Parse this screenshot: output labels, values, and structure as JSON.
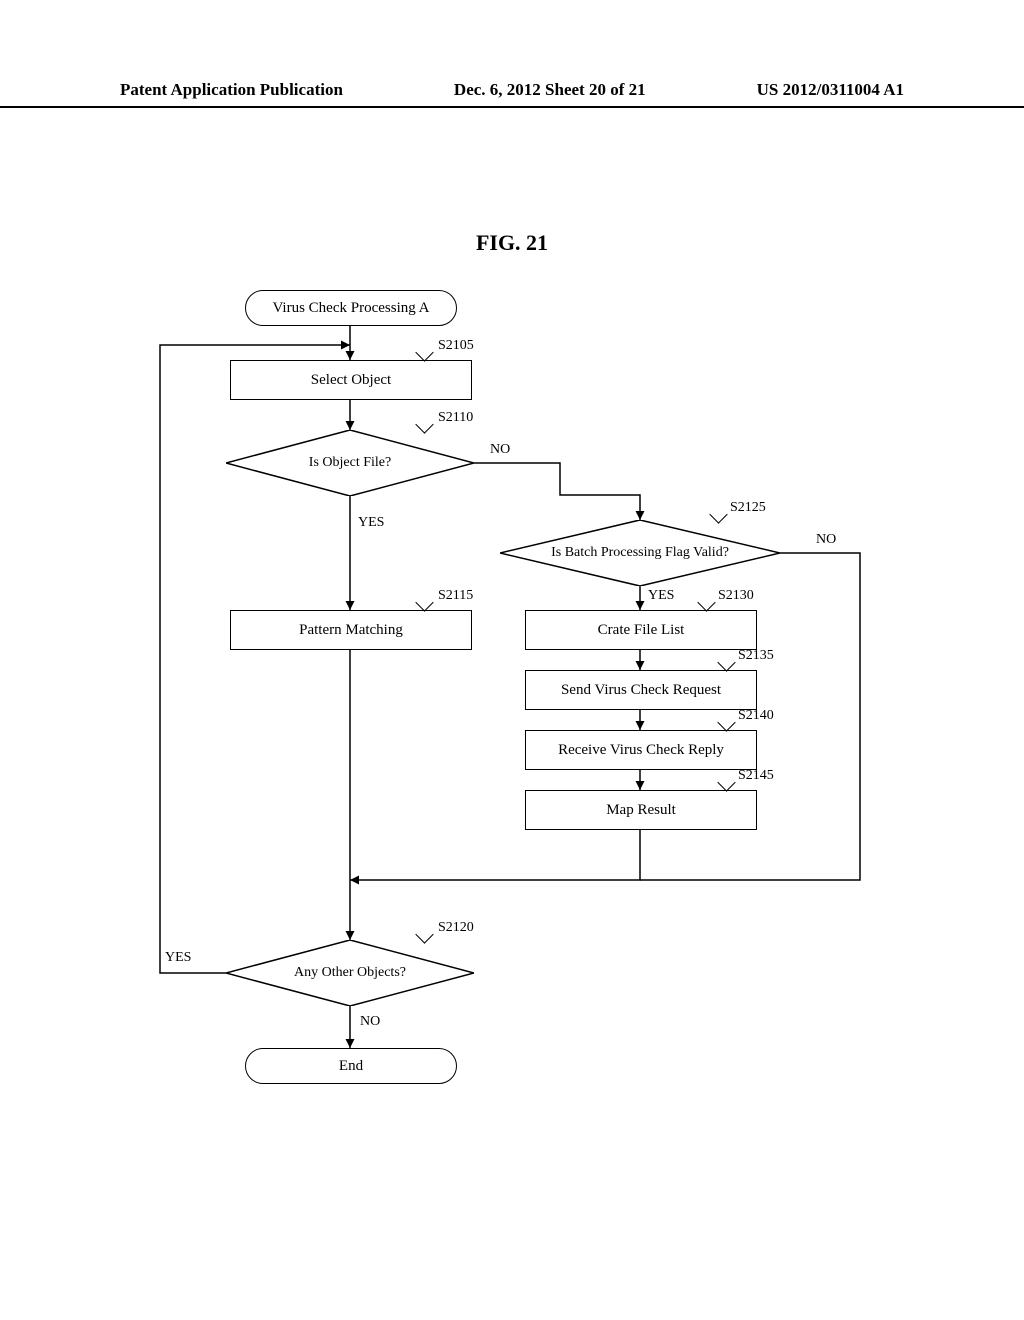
{
  "header": {
    "left": "Patent Application Publication",
    "center": "Dec. 6, 2012   Sheet 20 of 21",
    "right": "US 2012/0311004 A1"
  },
  "figure_title": "FIG. 21",
  "nodes": {
    "start": "Virus Check Processing A",
    "s2105": {
      "label": "S2105",
      "text": "Select Object"
    },
    "s2110": {
      "label": "S2110",
      "text": "Is Object File?",
      "yes": "YES",
      "no": "NO"
    },
    "s2115": {
      "label": "S2115",
      "text": "Pattern Matching"
    },
    "s2120": {
      "label": "S2120",
      "text": "Any Other Objects?",
      "yes": "YES",
      "no": "NO"
    },
    "s2125": {
      "label": "S2125",
      "text": "Is Batch Processing Flag Valid?",
      "yes": "YES",
      "no": "NO"
    },
    "s2130": {
      "label": "S2130",
      "text": "Crate File List"
    },
    "s2135": {
      "label": "S2135",
      "text": "Send Virus Check Request"
    },
    "s2140": {
      "label": "S2140",
      "text": "Receive Virus Check Reply"
    },
    "s2145": {
      "label": "S2145",
      "text": "Map Result"
    },
    "end": "End"
  }
}
